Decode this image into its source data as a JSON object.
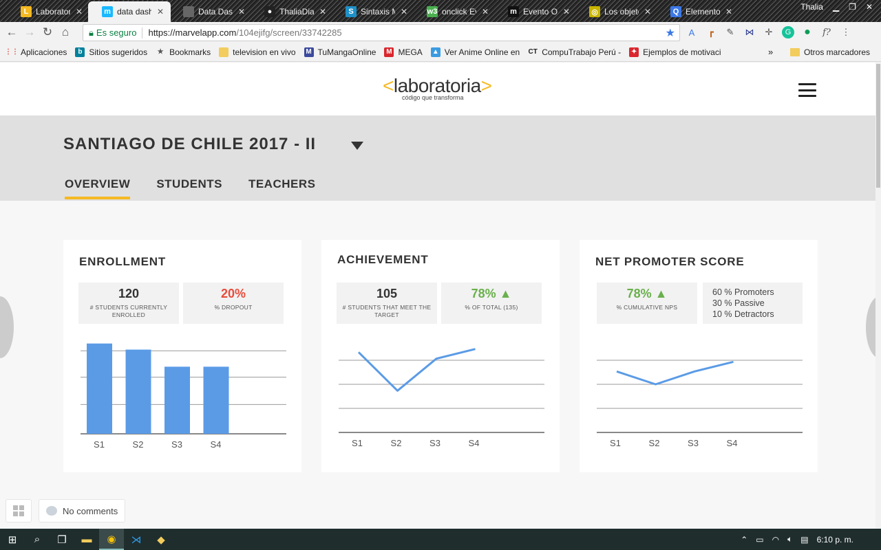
{
  "browser": {
    "tabs": [
      {
        "label": "Laboratoria",
        "icon": "laboratoria-icon",
        "icon_char": "L",
        "icon_color": "#f5b921",
        "active": false
      },
      {
        "label": "data dashb",
        "icon": "marvel-icon",
        "icon_char": "m",
        "icon_color": "#1ab9ff",
        "active": true
      },
      {
        "label": "Data Dash",
        "icon": "page-icon",
        "icon_char": "",
        "icon_color": "#666666",
        "active": false
      },
      {
        "label": "ThaliaDia",
        "icon": "github-icon",
        "icon_char": "●",
        "icon_color": "#222222",
        "active": false
      },
      {
        "label": "Sintaxis M",
        "icon": "doc-icon",
        "icon_char": "S",
        "icon_color": "#1e90c8",
        "active": false
      },
      {
        "label": "onclick Ev",
        "icon": "w3-icon",
        "icon_char": "w3",
        "icon_color": "#4caf50",
        "active": false
      },
      {
        "label": "Evento Or",
        "icon": "medium-icon",
        "icon_char": "m",
        "icon_color": "#111111",
        "active": false
      },
      {
        "label": "Los objeto",
        "icon": "js-icon",
        "icon_char": "◎",
        "icon_color": "#c9b400",
        "active": false
      },
      {
        "label": "Elemento",
        "icon": "elements-icon",
        "icon_char": "Q",
        "icon_color": "#3b78e7",
        "active": false
      }
    ],
    "window_user": "Thalia",
    "secure_label": "Es seguro",
    "url_host": "https://marvelapp.com",
    "url_path": "/104ejifg/screen/33742285"
  },
  "bookmarks": [
    {
      "label": "Aplicaciones",
      "icon": "apps-icon",
      "char": "⋮⋮",
      "color": "#e04a3f"
    },
    {
      "label": "Sitios sugeridos",
      "icon": "bing-icon",
      "char": "b",
      "color": "#00809d"
    },
    {
      "label": "Bookmarks",
      "icon": "star-icon",
      "char": "★",
      "color": "#555555"
    },
    {
      "label": "television en vivo",
      "icon": "folder-icon",
      "char": "",
      "color": "#f2cc5c"
    },
    {
      "label": "TuMangaOnline",
      "icon": "manga-icon",
      "char": "M",
      "color": "#3b4a9e"
    },
    {
      "label": "MEGA",
      "icon": "mega-icon",
      "char": "M",
      "color": "#d9272e"
    },
    {
      "label": "Ver Anime Online en",
      "icon": "anime-icon",
      "char": "▲",
      "color": "#3b9be0"
    },
    {
      "label": "CompuTrabajo Perú -",
      "icon": "computrabajo-icon",
      "char": "CT",
      "color": "#222222"
    },
    {
      "label": "Ejemplos de motivaci",
      "icon": "motivation-icon",
      "char": "✦",
      "color": "#d9272e"
    }
  ],
  "bookmarks_other": "Otros marcadores",
  "bookmarks_more": "»",
  "page": {
    "logo_text": "laboratoria",
    "logo_sub": "código que transforma",
    "title": "SANTIAGO DE CHILE 2017 - II",
    "tabs": [
      "OVERVIEW",
      "STUDENTS",
      "TEACHERS"
    ],
    "enrollment": {
      "title": "ENROLLMENT",
      "stat1_value": "120",
      "stat1_label": "# STUDENTS CURRENTLY ENROLLED",
      "stat2_value": "20%",
      "stat2_label": "% DROPOUT"
    },
    "achievement": {
      "title": "ACHIEVEMENT",
      "stat1_value": "105",
      "stat1_label": "# STUDENTS THAT MEET THE TARGET",
      "stat2_value": "78% ▲",
      "stat2_label": "% OF TOTAL (135)"
    },
    "nps": {
      "title": "NET PROMOTER SCORE",
      "stat1_value": "78% ▲",
      "stat1_label": "% CUMULATIVE NPS",
      "breakdown": [
        "60 %  Promoters",
        "30 %  Passive",
        "10 %  Detractors"
      ]
    },
    "comments_label": "No comments"
  },
  "chart_data": [
    {
      "type": "bar",
      "categories": [
        "S1",
        "S2",
        "S3",
        "S4"
      ],
      "values": [
        37,
        34.5,
        27.5,
        27.5
      ],
      "ylim": [
        0,
        40
      ],
      "color": "#5b9be6"
    },
    {
      "type": "line",
      "categories": [
        "S1",
        "S2",
        "S3",
        "S4"
      ],
      "values": [
        25,
        13,
        23,
        26
      ],
      "ylim": [
        0,
        30
      ],
      "color": "#5b9be6"
    },
    {
      "type": "line",
      "categories": [
        "S1",
        "S2",
        "S3",
        "S4"
      ],
      "values": [
        19,
        15,
        19,
        22
      ],
      "ylim": [
        0,
        30
      ],
      "color": "#5b9be6"
    }
  ],
  "taskbar": {
    "time": "6:10 p. m."
  }
}
